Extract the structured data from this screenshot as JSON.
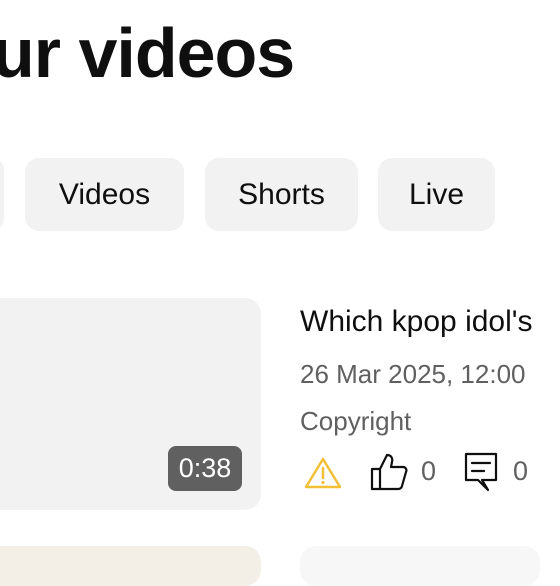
{
  "header": {
    "title": "ur videos"
  },
  "tabs": [
    {
      "label": ""
    },
    {
      "label": "Videos"
    },
    {
      "label": "Shorts"
    },
    {
      "label": "Live"
    }
  ],
  "videos": [
    {
      "title": "Which kpop idol's",
      "date": "26 Mar 2025, 12:00",
      "status": "Copyright",
      "duration": "0:38",
      "likes": "0",
      "comments": "0",
      "icons": {
        "warning": "warning-triangle-icon",
        "like": "thumbs-up-icon",
        "comment": "comment-icon"
      }
    }
  ],
  "colors": {
    "chip_background": "#f2f2f2",
    "thumbnail_background": "#f2f2f2",
    "duration_badge": "#606060",
    "warning": "#f2c037",
    "secondary_text": "#606060",
    "primary_text": "#0f0f0f"
  }
}
